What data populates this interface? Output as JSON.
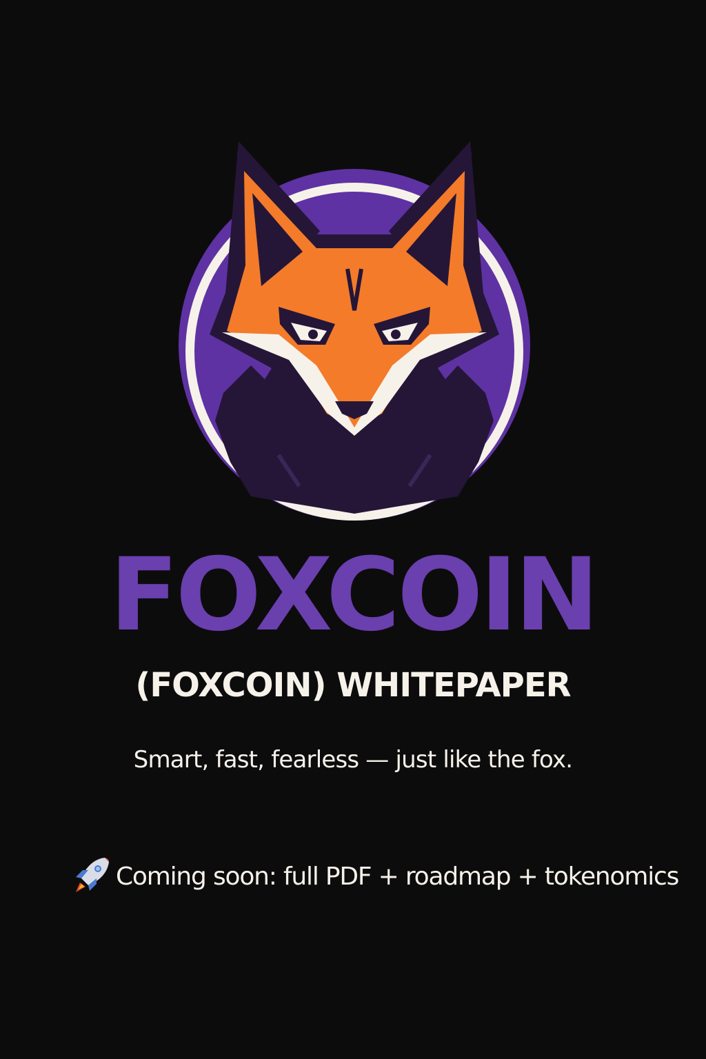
{
  "brand": {
    "name": "FOXCOIN",
    "subtitle": "(FOXCOIN) WHITEPAPER",
    "tagline": "Smart, fast, fearless — just like the fox."
  },
  "announcement": {
    "icon": "rocket-icon",
    "text": "Coming soon: full PDF + roadmap + tokenomics"
  },
  "colors": {
    "background": "#0d0c0d",
    "purple": "#6a3fae",
    "orange": "#f47b2a",
    "cream": "#f6f2ea",
    "dark_purple": "#251638"
  }
}
